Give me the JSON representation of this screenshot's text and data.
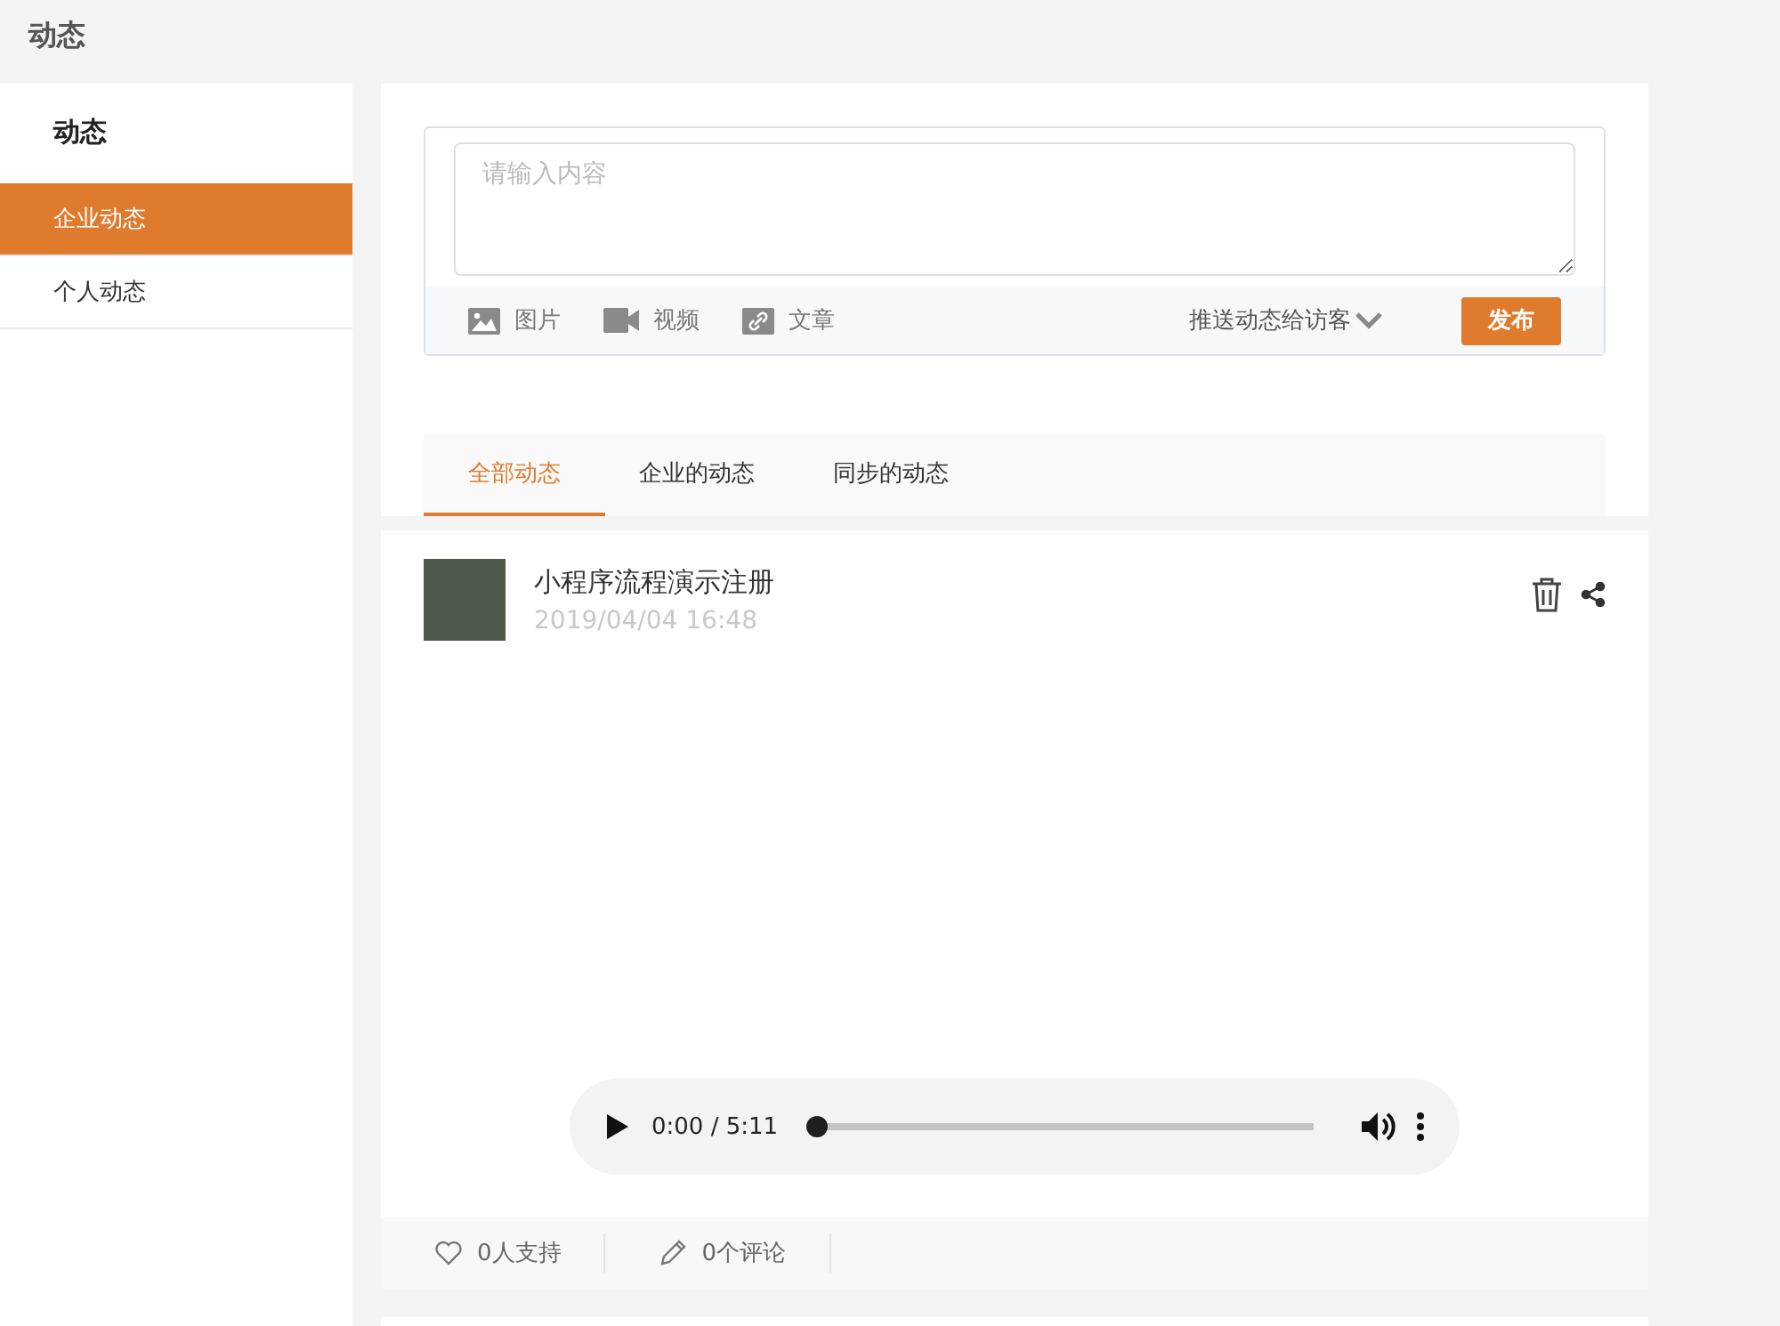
{
  "page_title": "动态",
  "sidebar": {
    "title": "动态",
    "items": [
      {
        "label": "企业动态",
        "selected": true
      },
      {
        "label": "个人动态",
        "selected": false
      }
    ]
  },
  "composer": {
    "placeholder": "请输入内容",
    "tools": [
      {
        "kind": "image",
        "label": "图片"
      },
      {
        "kind": "video",
        "label": "视频"
      },
      {
        "kind": "article",
        "label": "文章"
      }
    ],
    "push": "推送动态给访客",
    "publish": "发布"
  },
  "tabs": [
    {
      "label": "全部动态",
      "selected": true
    },
    {
      "label": "企业的动态",
      "selected": false
    },
    {
      "label": "同步的动态",
      "selected": false
    }
  ],
  "post": {
    "title": "小程序流程演示注册",
    "time": "2019/04/04 16:48",
    "audio": {
      "time": "0:00 / 5:11",
      "level": 0
    },
    "likes": "0人支持",
    "comments": "0个评论"
  }
}
